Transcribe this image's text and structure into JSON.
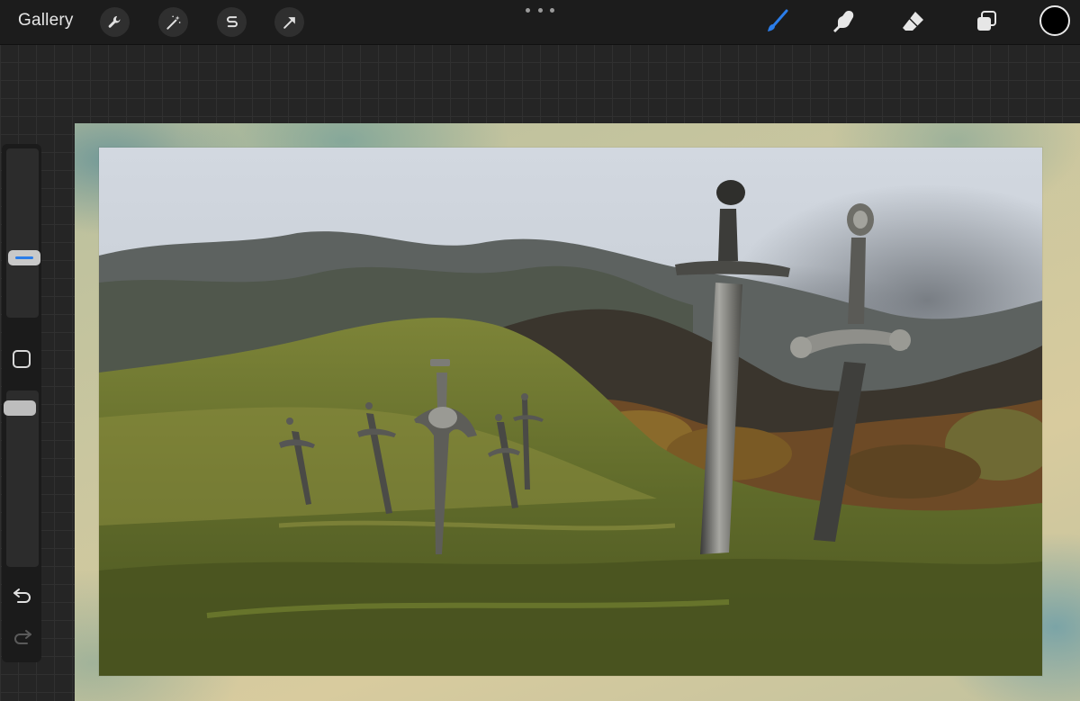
{
  "topbar": {
    "gallery_label": "Gallery",
    "left_tools": [
      {
        "name": "actions",
        "icon": "wrench-icon"
      },
      {
        "name": "adjustments",
        "icon": "magic-wand-icon"
      },
      {
        "name": "selection",
        "icon": "selection-s-icon"
      },
      {
        "name": "transform",
        "icon": "arrow-cursor-icon"
      }
    ],
    "more_menu_icon": "more-dots-icon",
    "right_tools": [
      {
        "name": "brush",
        "icon": "brush-icon",
        "active": true
      },
      {
        "name": "smudge",
        "icon": "smudge-finger-icon",
        "active": false
      },
      {
        "name": "eraser",
        "icon": "eraser-icon",
        "active": false
      },
      {
        "name": "layers",
        "icon": "layers-icon",
        "active": false
      }
    ],
    "current_color": "#000000",
    "active_tool_color": "#2b7de9"
  },
  "sidebar": {
    "brush_size_level": 0.62,
    "opacity_level": 0.15,
    "undo_icon": "undo-icon",
    "redo_icon": "redo-icon",
    "modify_icon": "square-modify-icon"
  },
  "canvas": {
    "artwork": "sword-graveyard-landscape-painting"
  }
}
